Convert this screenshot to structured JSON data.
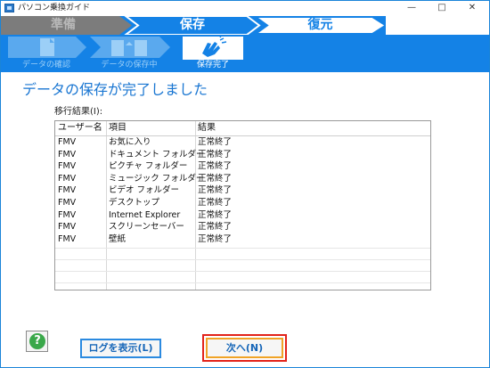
{
  "window": {
    "title": "パソコン乗換ガイド"
  },
  "steps": [
    {
      "label": "準備",
      "state": "done"
    },
    {
      "label": "保存",
      "state": "active"
    },
    {
      "label": "復元",
      "state": "upcoming"
    }
  ],
  "substeps": [
    {
      "label": "データの確認",
      "icon": "document-check-icon",
      "active": false
    },
    {
      "label": "データの保存中",
      "icon": "document-copy-icon",
      "active": false
    },
    {
      "label": "保存完了",
      "icon": "clapping-hands-icon",
      "active": true
    }
  ],
  "main": {
    "heading": "データの保存が完了しました",
    "result_label": "移行結果(I):",
    "columns": [
      "ユーザー名",
      "項目",
      "結果"
    ],
    "rows": [
      [
        "FMV",
        "お気に入り",
        "正常終了"
      ],
      [
        "FMV",
        "ドキュメント フォルダー",
        "正常終了"
      ],
      [
        "FMV",
        "ピクチャ フォルダー",
        "正常終了"
      ],
      [
        "FMV",
        "ミュージック フォルダー",
        "正常終了"
      ],
      [
        "FMV",
        "ビデオ フォルダー",
        "正常終了"
      ],
      [
        "FMV",
        "デスクトップ",
        "正常終了"
      ],
      [
        "FMV",
        "Internet Explorer",
        "正常終了"
      ],
      [
        "FMV",
        "スクリーンセーバー",
        "正常終了"
      ],
      [
        "FMV",
        "壁紙",
        "正常終了"
      ]
    ]
  },
  "buttons": {
    "help": "?",
    "show_log": "ログを表示(L)",
    "next": "次へ(N)"
  },
  "colors": {
    "accent": "#1482e6",
    "heading": "#1976d2",
    "highlight_red": "#e2231a",
    "highlight_orange": "#f0a326"
  }
}
